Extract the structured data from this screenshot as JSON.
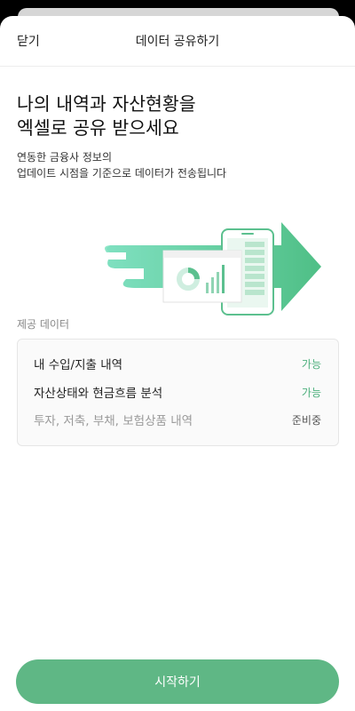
{
  "header": {
    "close_label": "닫기",
    "title": "데이터 공유하기"
  },
  "intro": {
    "headline_line1": "나의 내역과 자산현황을",
    "headline_line2": "엑셀로 공유 받으세요",
    "sub_line1": "연동한 금융사 정보의",
    "sub_line2": "업데이트 시점을 기준으로 데이터가 전송됩니다"
  },
  "provided": {
    "section_label": "제공 데이터",
    "items": [
      {
        "name": "내 수입/지출 내역",
        "status": "가능"
      },
      {
        "name": "자산상태와 현금흐름 분석",
        "status": "가능"
      },
      {
        "name": "투자, 저축, 부채, 보험상품 내역",
        "status": "준비중"
      }
    ]
  },
  "footer": {
    "start_label": "시작하기"
  },
  "colors": {
    "accent_green": "#5fb785",
    "status_available": "#4caf7c"
  },
  "icons": {
    "illustration": "spreadsheet-share-illustration"
  }
}
